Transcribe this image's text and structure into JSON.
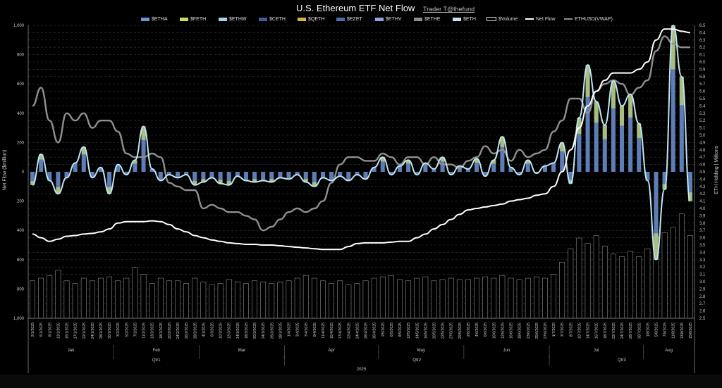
{
  "header": {
    "title": "U.S. Ethereum ETF Net Flow",
    "credit": "Trader T@thefund"
  },
  "legend": [
    {
      "label": "$ETHA",
      "color": "#6f93d6"
    },
    {
      "label": "$FETH",
      "color": "#c9d96a"
    },
    {
      "label": "$ETHW",
      "color": "#9fd3e6"
    },
    {
      "label": "$CETH",
      "color": "#3e5f9a"
    },
    {
      "label": "$QETH",
      "color": "#d8b04a"
    },
    {
      "label": "$EZET",
      "color": "#4a6fa8"
    },
    {
      "label": "$ETHV",
      "color": "#8aa6e0"
    },
    {
      "label": "$ETHE",
      "color": "#8c8c8c"
    },
    {
      "label": "$ETH",
      "color": "#bfe6f2"
    },
    {
      "label": "$Volume",
      "color": "#000000"
    },
    {
      "label": "Net Flow",
      "color": "#ffffff"
    },
    {
      "label": "ETHUSD(VWAP)",
      "color": "#8f8f8f"
    }
  ],
  "chart_data": {
    "type": "bar",
    "title": "U.S. Ethereum ETF Net Flow",
    "ylabel": "Net Flow ($million)",
    "y2label": "ETH Holding | Millions",
    "ylim": [
      -1000,
      1000
    ],
    "y_ticks": [
      "1,000",
      "800",
      "600",
      "400",
      "200",
      "0",
      "200",
      "400",
      "600",
      "800",
      "1,000"
    ],
    "y2lim": [
      2.5,
      6.5
    ],
    "y2_ticks": [
      "6.5",
      "6.4",
      "6.3",
      "6.2",
      "6.1",
      "6.0",
      "5.9",
      "5.8",
      "5.7",
      "5.6",
      "5.5",
      "5.4",
      "5.3",
      "5.2",
      "5.1",
      "5.0",
      "4.9",
      "4.8",
      "4.7",
      "4.6",
      "4.5",
      "4.4",
      "4.3",
      "4.2",
      "4.1",
      "4.0",
      "3.9",
      "3.8",
      "3.7",
      "3.6",
      "3.5",
      "3.4",
      "3.3",
      "3.2",
      "3.1",
      "3.0",
      "2.9",
      "2.8",
      "2.7",
      "2.6",
      "2.5"
    ],
    "x_dates": [
      "2/1/2025",
      "6/1/2025",
      "8/1/2025",
      "13/1/2025",
      "15/1/2025",
      "17/1/2025",
      "22/1/2025",
      "24/1/2025",
      "28/1/2025",
      "30/1/2025",
      "3/2/2025",
      "5/2/2025",
      "7/2/2025",
      "11/2/2025",
      "13/2/2025",
      "18/2/2025",
      "20/2/2025",
      "24/2/2025",
      "26/2/2025",
      "28/2/2025",
      "4/3/2025",
      "6/3/2025",
      "10/3/2025",
      "12/3/2025",
      "14/3/2025",
      "18/3/2025",
      "20/3/2025",
      "24/3/2025",
      "26/3/2025",
      "28/3/2025",
      "1/4/2025",
      "3/4/2025",
      "7/4/2025",
      "9/4/2025",
      "11/4/2025",
      "15/4/2025",
      "17/4/2025",
      "22/4/2025",
      "24/4/2025",
      "28/4/2025",
      "30/4/2025",
      "2/5/2025",
      "6/5/2025",
      "8/5/2025",
      "12/5/2025",
      "14/5/2025",
      "16/5/2025",
      "20/5/2025",
      "22/5/2025",
      "27/5/2025",
      "29/5/2025",
      "2/6/2025",
      "4/6/2025",
      "6/6/2025",
      "10/6/2025",
      "12/6/2025",
      "16/6/2025",
      "18/6/2025",
      "23/6/2025",
      "25/6/2025",
      "27/6/2025",
      "1/7/2025",
      "3/7/2025",
      "8/7/2025",
      "10/7/2025",
      "14/7/2025",
      "16/7/2025",
      "18/7/2025",
      "22/7/2025",
      "24/7/2025",
      "28/7/2025",
      "30/7/2025",
      "1/8/2025",
      "5/8/2025",
      "7/8/2025",
      "11/8/2025",
      "13/8/2025",
      "15/8/2025"
    ],
    "months": [
      "Jan",
      "Feb",
      "Mar",
      "Apr",
      "May",
      "Jun",
      "Jul",
      "Aug"
    ],
    "quarters": [
      "Qtr1",
      "Qtr2",
      "Qtr3"
    ],
    "year": "2025",
    "net_flow": [
      -90,
      120,
      -60,
      -150,
      -40,
      60,
      170,
      -40,
      30,
      -150,
      50,
      -20,
      80,
      310,
      20,
      -60,
      -20,
      -40,
      -20,
      -90,
      -70,
      -40,
      -80,
      -90,
      -30,
      -60,
      -70,
      -60,
      -70,
      -40,
      -50,
      -20,
      -70,
      -100,
      -40,
      -60,
      -30,
      -60,
      -20,
      -50,
      30,
      100,
      -20,
      40,
      80,
      -20,
      60,
      20,
      100,
      -20,
      40,
      20,
      90,
      -30,
      80,
      240,
      30,
      -20,
      80,
      -10,
      40,
      60,
      200,
      -80,
      370,
      730,
      480,
      320,
      620,
      450,
      530,
      330,
      -60,
      -600,
      -120,
      1000,
      650,
      -200
    ],
    "eth_price_vwap": [
      5.4,
      5.65,
      5.2,
      4.9,
      5.3,
      5.2,
      5.3,
      5.1,
      5.2,
      5.2,
      5.05,
      4.75,
      4.7,
      4.7,
      4.75,
      4.7,
      4.35,
      4.3,
      4.25,
      4.25,
      4.0,
      4.05,
      4.0,
      3.95,
      3.95,
      3.9,
      3.85,
      3.7,
      3.75,
      3.85,
      3.95,
      4.0,
      3.95,
      4.0,
      4.1,
      4.35,
      4.6,
      4.7,
      4.7,
      4.65,
      4.65,
      4.75,
      4.7,
      4.6,
      4.7,
      4.7,
      4.6,
      4.7,
      4.6,
      4.6,
      4.55,
      4.65,
      4.7,
      4.85,
      4.75,
      4.8,
      4.65,
      4.8,
      4.7,
      4.75,
      4.8,
      5.05,
      5.2,
      5.5,
      5.5,
      5.3,
      5.6,
      5.7,
      5.75,
      5.7,
      5.55,
      5.65,
      5.75,
      6.15,
      6.35,
      6.25,
      6.2,
      6.2
    ],
    "eth_holding": [
      3.65,
      3.6,
      3.55,
      3.58,
      3.62,
      3.63,
      3.65,
      3.66,
      3.68,
      3.72,
      3.8,
      3.82,
      3.82,
      3.82,
      3.83,
      3.82,
      3.78,
      3.72,
      3.68,
      3.63,
      3.6,
      3.57,
      3.55,
      3.53,
      3.52,
      3.51,
      3.51,
      3.5,
      3.5,
      3.49,
      3.48,
      3.47,
      3.46,
      3.45,
      3.44,
      3.44,
      3.44,
      3.48,
      3.52,
      3.53,
      3.53,
      3.53,
      3.54,
      3.55,
      3.55,
      3.6,
      3.65,
      3.72,
      3.78,
      3.85,
      3.92,
      3.98,
      4.0,
      4.02,
      4.04,
      4.06,
      4.1,
      4.12,
      4.14,
      4.18,
      4.2,
      4.3,
      4.5,
      4.8,
      5.1,
      5.4,
      5.6,
      5.75,
      5.85,
      5.85,
      5.85,
      5.9,
      6.0,
      6.3,
      6.45,
      6.45,
      6.42,
      6.4
    ],
    "volume": [
      280,
      300,
      320,
      360,
      280,
      260,
      300,
      280,
      300,
      310,
      280,
      300,
      380,
      330,
      260,
      300,
      280,
      280,
      260,
      300,
      270,
      250,
      260,
      290,
      270,
      260,
      280,
      270,
      260,
      270,
      280,
      300,
      320,
      300,
      280,
      260,
      280,
      250,
      260,
      280,
      300,
      310,
      320,
      290,
      280,
      300,
      310,
      280,
      290,
      300,
      290,
      290,
      300,
      310,
      300,
      320,
      300,
      290,
      300,
      310,
      300,
      330,
      420,
      520,
      600,
      560,
      620,
      540,
      480,
      460,
      500,
      460,
      520,
      610,
      640,
      680,
      780,
      620
    ]
  }
}
